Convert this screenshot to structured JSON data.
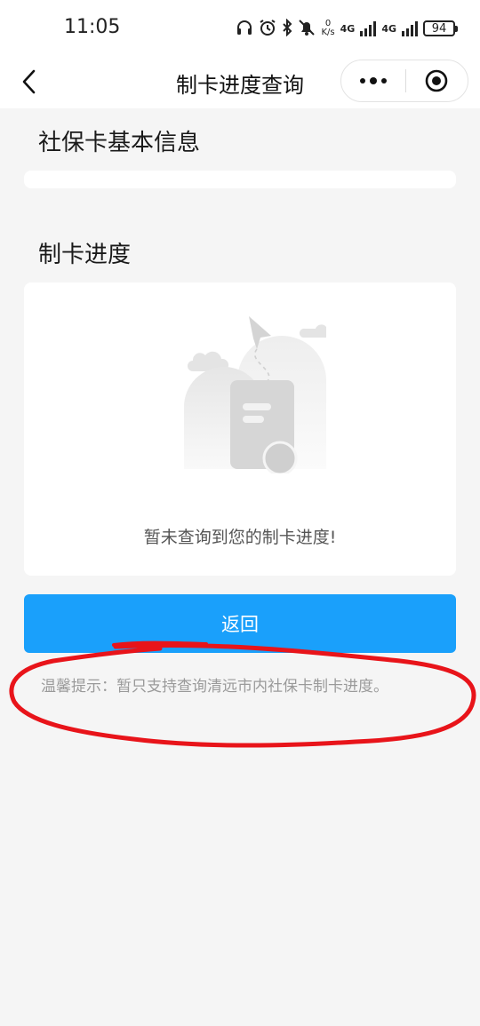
{
  "status_bar": {
    "time": "11:05",
    "speed_value": "0",
    "speed_unit": "K/s",
    "network_1": "4G",
    "network_2": "4G",
    "battery": "94"
  },
  "nav": {
    "title": "制卡进度查询"
  },
  "basic_info": {
    "title": "社保卡基本信息"
  },
  "progress": {
    "title": "制卡进度",
    "empty_text": "暂未查询到您的制卡进度!"
  },
  "actions": {
    "back_label": "返回"
  },
  "tip": {
    "text": "温馨提示：暂只支持查询清远市内社保卡制卡进度。"
  },
  "colors": {
    "primary": "#1aa0fb",
    "annotation": "#e8141a",
    "background": "#f5f5f5"
  }
}
